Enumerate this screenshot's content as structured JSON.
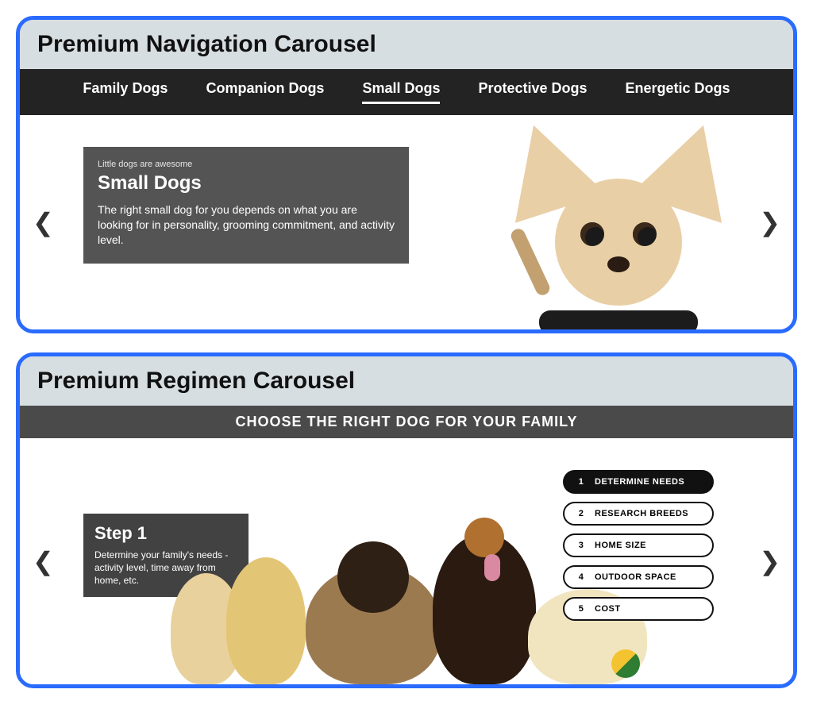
{
  "panel1": {
    "title": "Premium Navigation Carousel",
    "tabs": [
      "Family Dogs",
      "Companion Dogs",
      "Small Dogs",
      "Protective Dogs",
      "Energetic Dogs"
    ],
    "activeTab": 2,
    "caption": {
      "eyebrow": "Little dogs are awesome",
      "title": "Small Dogs",
      "body": "The right small dog for you depends on what you are looking for in personality, grooming commitment, and activity level."
    }
  },
  "panel2": {
    "title": "Premium Regimen Carousel",
    "banner": "CHOOSE THE RIGHT DOG FOR YOUR FAMILY",
    "step": {
      "title": "Step 1",
      "desc": "Determine your family's needs - activity level, time away from home, etc."
    },
    "steps": [
      {
        "num": "1",
        "label": "DETERMINE NEEDS"
      },
      {
        "num": "2",
        "label": "RESEARCH BREEDS"
      },
      {
        "num": "3",
        "label": "HOME SIZE"
      },
      {
        "num": "4",
        "label": "OUTDOOR SPACE"
      },
      {
        "num": "5",
        "label": "COST"
      }
    ],
    "activeStep": 0
  }
}
